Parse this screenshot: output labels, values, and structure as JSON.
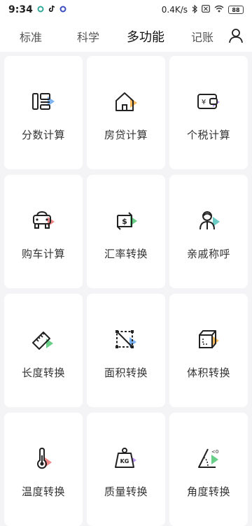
{
  "status_bar": {
    "time": "9:34",
    "network_speed": "0.4K/s",
    "battery": "88",
    "icons": [
      "app-notification-icon",
      "tiktok-icon",
      "circle-app-icon",
      "bluetooth-icon",
      "sim-icon",
      "wifi-icon",
      "battery-icon"
    ]
  },
  "tabs": [
    {
      "label": "标准",
      "active": false
    },
    {
      "label": "科学",
      "active": false
    },
    {
      "label": "多功能",
      "active": true
    },
    {
      "label": "记账",
      "active": false
    }
  ],
  "accent_colors": {
    "blue": "#6aa8f0",
    "orange": "#f5b14a",
    "purple": "#b58cf5",
    "red": "#f07b7b",
    "green": "#59c97a",
    "teal": "#5cc6c0"
  },
  "tools": [
    {
      "label": "分数计算",
      "icon": "fraction-icon",
      "accent": "#6aa8f0"
    },
    {
      "label": "房贷计算",
      "icon": "house-icon",
      "accent": "#f5b14a"
    },
    {
      "label": "个税计算",
      "icon": "wallet-yen-icon",
      "accent": "#b58cf5"
    },
    {
      "label": "购车计算",
      "icon": "car-icon",
      "accent": "#f07b7b"
    },
    {
      "label": "汇率转换",
      "icon": "exchange-dollar-icon",
      "accent": "#59c97a"
    },
    {
      "label": "亲戚称呼",
      "icon": "relatives-icon",
      "accent": "#5cc6c0"
    },
    {
      "label": "长度转换",
      "icon": "ruler-icon",
      "accent": "#59c97a"
    },
    {
      "label": "面积转换",
      "icon": "area-icon",
      "accent": "#6aa8f0"
    },
    {
      "label": "体积转换",
      "icon": "cube-icon",
      "accent": "#f5b14a"
    },
    {
      "label": "温度转换",
      "icon": "thermometer-icon",
      "accent": "#f07b7b"
    },
    {
      "label": "质量转换",
      "icon": "weight-kg-icon",
      "accent": "#b58cf5"
    },
    {
      "label": "角度转换",
      "icon": "angle-icon",
      "accent": "#59c97a"
    }
  ]
}
